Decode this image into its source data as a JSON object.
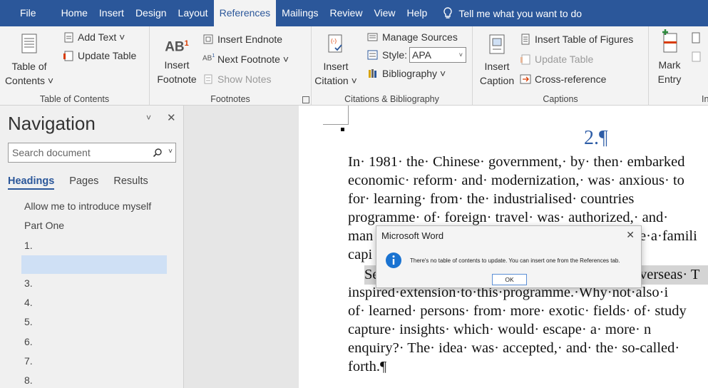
{
  "menubar": {
    "tabs": [
      "File",
      "Home",
      "Insert",
      "Design",
      "Layout",
      "References",
      "Mailings",
      "Review",
      "View",
      "Help"
    ],
    "active_tab": "References",
    "tell_me": "Tell me what you want to do",
    "color": "#2b579a"
  },
  "ribbon": {
    "toc": {
      "big_label_1": "Table of",
      "big_label_2": "Contents ˅",
      "add_text": "Add Text ˅",
      "update_table": "Update Table",
      "group_label": "Table of Contents"
    },
    "footnotes": {
      "insert_footnote_1": "Insert",
      "insert_footnote_2": "Footnote",
      "insert_endnote": "Insert Endnote",
      "next_footnote": "Next Footnote ˅",
      "show_notes": "Show Notes",
      "group_label": "Footnotes"
    },
    "citations": {
      "insert_citation_1": "Insert",
      "insert_citation_2": "Citation ˅",
      "manage_sources": "Manage Sources",
      "style_label": "Style:",
      "style_value": "APA",
      "bibliography": "Bibliography ˅",
      "group_label": "Citations & Bibliography"
    },
    "captions": {
      "insert_caption_1": "Insert",
      "insert_caption_2": "Caption",
      "insert_table_of_figures": "Insert Table of Figures",
      "update_table": "Update Table",
      "cross_reference": "Cross-reference",
      "group_label": "Captions"
    },
    "index": {
      "mark_entry_1": "Mark",
      "mark_entry_2": "Entry",
      "group_label_partial": "In"
    }
  },
  "navigation": {
    "title": "Navigation",
    "search_placeholder": "Search document",
    "tabs": [
      "Headings",
      "Pages",
      "Results"
    ],
    "active_tab": "Headings",
    "headings": [
      "Allow me to introduce myself",
      "Part One",
      "1.",
      "",
      "3.",
      "4.",
      "5.",
      "6.",
      "7.",
      "8."
    ],
    "selected_index": 3
  },
  "document": {
    "heading": "2.¶",
    "lines": [
      "In· 1981· the· Chinese· government,· by· then· embarked",
      "economic· reform· and· modernization,· was· anxious· to",
      "for·  learning·  from·  the·  industrialised·  countries",
      "programme· of· foreign· travel· was· authorized,· and·",
      "man",
      "capi"
    ],
    "line4_right": "e·a·famili",
    "line6_left": "Se",
    "line6_right": "verseas· T",
    "lines_after": [
      "inspired·extension·to·this·programme.·Why·not·also·i",
      "of· learned· persons· from· more· exotic· fields· of· study",
      "capture·  insights·  which·  would·  escape·  a·  more·  n",
      "enquiry?· The· idea· was· accepted,· and· the· so-called·",
      "forth.¶"
    ]
  },
  "dialog": {
    "title": "Microsoft Word",
    "message": "There's no table of contents to update. You can insert one from the References tab.",
    "ok_label": "OK",
    "icon": "info-icon",
    "icon_color": "#1a73d1"
  }
}
